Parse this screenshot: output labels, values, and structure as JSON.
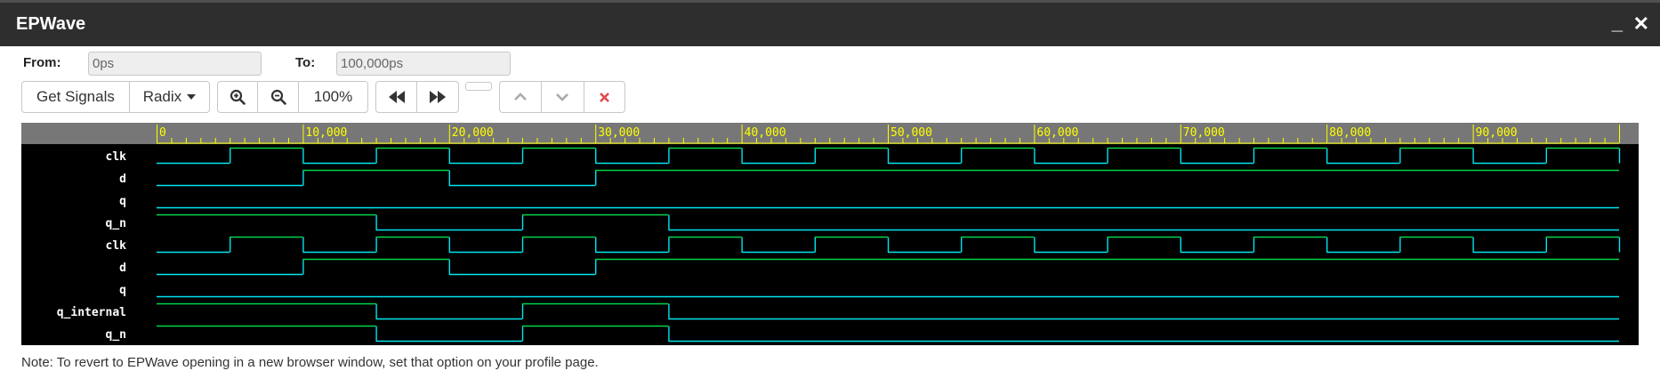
{
  "window": {
    "title": "EPWave"
  },
  "range": {
    "from_label": "From:",
    "from_value": "0ps",
    "to_label": "To:",
    "to_value": "100,000ps"
  },
  "toolbar": {
    "get_signals_label": "Get Signals",
    "radix_label": "Radix",
    "zoom_level": "100%"
  },
  "colors": {
    "header_bg": "#777777",
    "tick_color": "#ffff00",
    "wave_bg": "#000000",
    "clock_line": "#00e5ee",
    "signal_high": "#00d44a",
    "signal_low": "#00e5ee",
    "name_text": "#ffffff",
    "delete_red": "#e04a4a"
  },
  "timeline": {
    "tick_labels": [
      "0",
      "10,000",
      "20,000",
      "30,000",
      "40,000",
      "50,000",
      "60,000",
      "70,000",
      "80,000",
      "90,000"
    ]
  },
  "waveform": {
    "time_range": [
      0,
      100000
    ],
    "signals": [
      {
        "name": "clk",
        "initial": 0,
        "transitions": [
          5000,
          10000,
          15000,
          20000,
          25000,
          30000,
          35000,
          40000,
          45000,
          50000,
          55000,
          60000,
          65000,
          70000,
          75000,
          80000,
          85000,
          90000,
          95000,
          100000
        ]
      },
      {
        "name": "d",
        "initial": 0,
        "transitions": [
          10000,
          20000,
          30000
        ]
      },
      {
        "name": "q",
        "initial": 0,
        "transitions": []
      },
      {
        "name": "q_n",
        "initial": 1,
        "transitions": [
          15000,
          25000,
          35000
        ]
      },
      {
        "name": "clk",
        "initial": 0,
        "transitions": [
          5000,
          10000,
          15000,
          20000,
          25000,
          30000,
          35000,
          40000,
          45000,
          50000,
          55000,
          60000,
          65000,
          70000,
          75000,
          80000,
          85000,
          90000,
          95000,
          100000
        ]
      },
      {
        "name": "d",
        "initial": 0,
        "transitions": [
          10000,
          20000,
          30000
        ]
      },
      {
        "name": "q",
        "initial": 0,
        "transitions": []
      },
      {
        "name": "q_internal",
        "initial": 1,
        "transitions": [
          15000,
          25000,
          35000
        ]
      },
      {
        "name": "q_n",
        "initial": 1,
        "transitions": [
          15000,
          25000,
          35000
        ]
      }
    ]
  },
  "footer": {
    "note": "Note: To revert to EPWave opening in a new browser window, set that option on your profile page."
  },
  "icons": {
    "zoom_in": "zoom-in-icon",
    "zoom_out": "zoom-out-icon",
    "prev": "rewind-icon",
    "next": "fast-forward-icon",
    "up": "chevron-up-icon",
    "down": "chevron-down-icon",
    "delete": "close-icon"
  }
}
